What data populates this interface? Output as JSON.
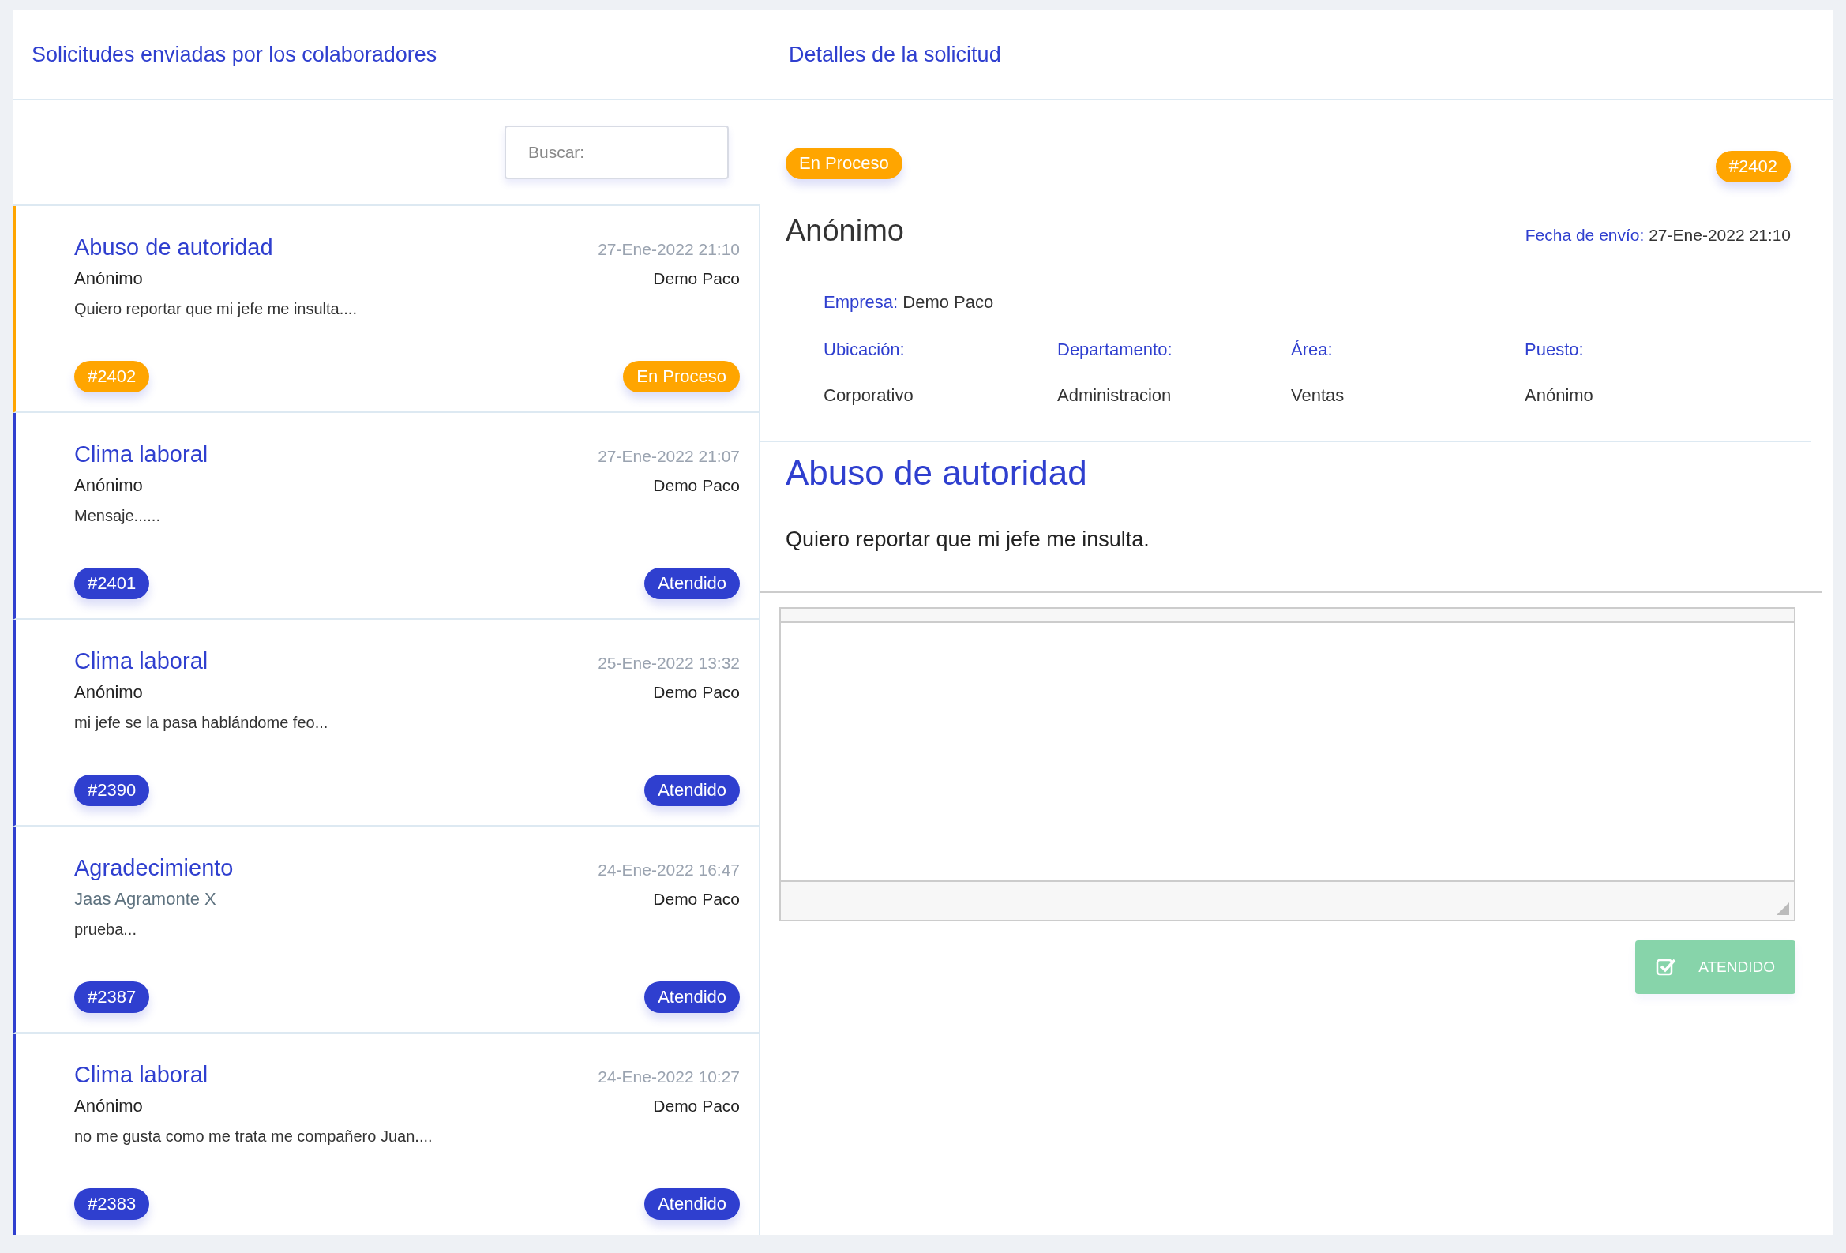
{
  "list_panel": {
    "title": "Solicitudes enviadas por los colaboradores",
    "search": {
      "placeholder": "Buscar:"
    }
  },
  "requests": [
    {
      "subject": "Abuso de autoridad",
      "date": "27-Ene-2022 21:10",
      "sender": "Anónimo",
      "identified": false,
      "company": "Demo Paco",
      "excerpt": "Quiero reportar que mi jefe me insulta....",
      "number": "#2402",
      "status": "En Proceso",
      "kind": "in_progress"
    },
    {
      "subject": "Clima laboral",
      "date": "27-Ene-2022 21:07",
      "sender": "Anónimo",
      "identified": false,
      "company": "Demo Paco",
      "excerpt": "Mensaje......",
      "number": "#2401",
      "status": "Atendido",
      "kind": "attended"
    },
    {
      "subject": "Clima laboral",
      "date": "25-Ene-2022 13:32",
      "sender": "Anónimo",
      "identified": false,
      "company": "Demo Paco",
      "excerpt": "mi jefe se la pasa hablándome feo...",
      "number": "#2390",
      "status": "Atendido",
      "kind": "attended"
    },
    {
      "subject": "Agradecimiento",
      "date": "24-Ene-2022 16:47",
      "sender": "Jaas Agramonte X",
      "identified": true,
      "company": "Demo Paco",
      "excerpt": "prueba...",
      "number": "#2387",
      "status": "Atendido",
      "kind": "attended"
    },
    {
      "subject": "Clima laboral",
      "date": "24-Ene-2022 10:27",
      "sender": "Anónimo",
      "identified": false,
      "company": "Demo Paco",
      "excerpt": "no me gusta como me trata me compañero Juan....",
      "number": "#2383",
      "status": "Atendido",
      "kind": "attended"
    }
  ],
  "detail_panel": {
    "title": "Detalles de la solicitud",
    "status": "En Proceso",
    "kind": "in_progress",
    "number": "#2402",
    "sender": "Anónimo",
    "date_label": "Fecha de envío:",
    "date": "27-Ene-2022 21:10",
    "company_label": "Empresa:",
    "company": "Demo Paco",
    "fields": [
      {
        "label": "Ubicación:",
        "value": "Corporativo"
      },
      {
        "label": "Departamento:",
        "value": "Administracion"
      },
      {
        "label": "Área:",
        "value": "Ventas"
      },
      {
        "label": "Puesto:",
        "value": "Anónimo"
      }
    ],
    "subject": "Abuso de autoridad",
    "message": "Quiero reportar que mi jefe me insulta.",
    "button": {
      "label": "ATENDIDO",
      "disabled": true
    }
  }
}
